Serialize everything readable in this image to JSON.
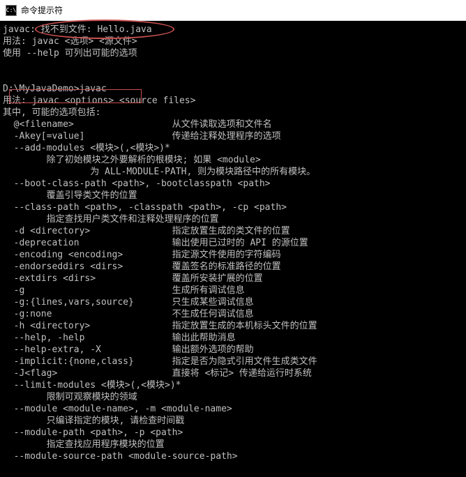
{
  "titlebar": {
    "icon_text": "C:\\",
    "title": "命令提示符"
  },
  "terminal": {
    "lines": [
      "javac: 找不到文件: Hello.java",
      "用法: javac <选项> <源文件>",
      "使用 --help 可列出可能的选项",
      "",
      "",
      "D:\\MyJavaDemo>javac",
      "用法: javac <options> <source files>",
      "其中, 可能的选项包括:",
      "  @<filename>                  从文件读取选项和文件名",
      "  -Akey[=value]                传递给注释处理程序的选项",
      "  --add-modules <模块>(,<模块>)*",
      "        除了初始模块之外要解析的根模块; 如果 <module>",
      "                为 ALL-MODULE-PATH, 则为模块路径中的所有模块。",
      "  --boot-class-path <path>, -bootclasspath <path>",
      "        覆盖引导类文件的位置",
      "  --class-path <path>, -classpath <path>, -cp <path>",
      "        指定查找用户类文件和注释处理程序的位置",
      "  -d <directory>               指定放置生成的类文件的位置",
      "  -deprecation                 输出使用已过时的 API 的源位置",
      "  -encoding <encoding>         指定源文件使用的字符编码",
      "  -endorseddirs <dirs>         覆盖签名的标准路径的位置",
      "  -extdirs <dirs>              覆盖所安装扩展的位置",
      "  -g                           生成所有调试信息",
      "  -g:{lines,vars,source}       只生成某些调试信息",
      "  -g:none                      不生成任何调试信息",
      "  -h <directory>               指定放置生成的本机标头文件的位置",
      "  --help, -help                输出此帮助消息",
      "  --help-extra, -X             输出额外选项的帮助",
      "  -implicit:{none,class}       指定是否为隐式引用文件生成类文件",
      "  -J<flag>                     直接将 <标记> 传递给运行时系统",
      "  --limit-modules <模块>(,<模块>)*",
      "        限制可观察模块的领域",
      "  --module <module-name>, -m <module-name>",
      "        只编译指定的模块, 请检查时间戳",
      "  --module-path <path>, -p <path>",
      "        指定查找应用程序模块的位置",
      "  --module-source-path <module-source-path>"
    ]
  }
}
